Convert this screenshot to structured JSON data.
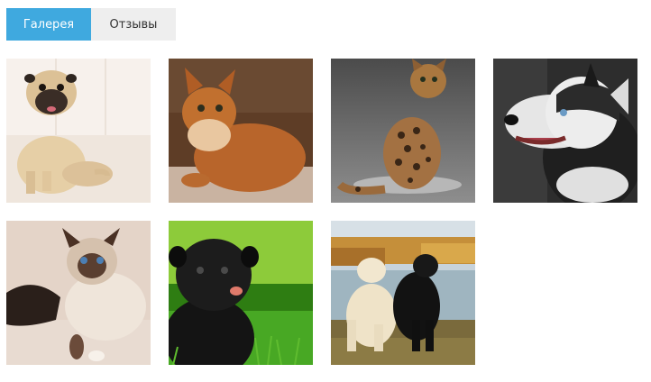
{
  "tabs": [
    {
      "label": "Галерея",
      "active": true
    },
    {
      "label": "Отзывы",
      "active": false
    }
  ],
  "colors": {
    "tab_active_bg": "#3fa9df",
    "tab_inactive_bg": "#eeeeee"
  },
  "gallery": {
    "items": [
      {
        "subject": "pug-fawn"
      },
      {
        "subject": "cat-orange-fluffy"
      },
      {
        "subject": "cat-bengal-spotted"
      },
      {
        "subject": "dog-husky"
      },
      {
        "subject": "cat-siamese-fluffy"
      },
      {
        "subject": "pug-black"
      },
      {
        "subject": "labradors-yellow-and-black"
      }
    ]
  }
}
